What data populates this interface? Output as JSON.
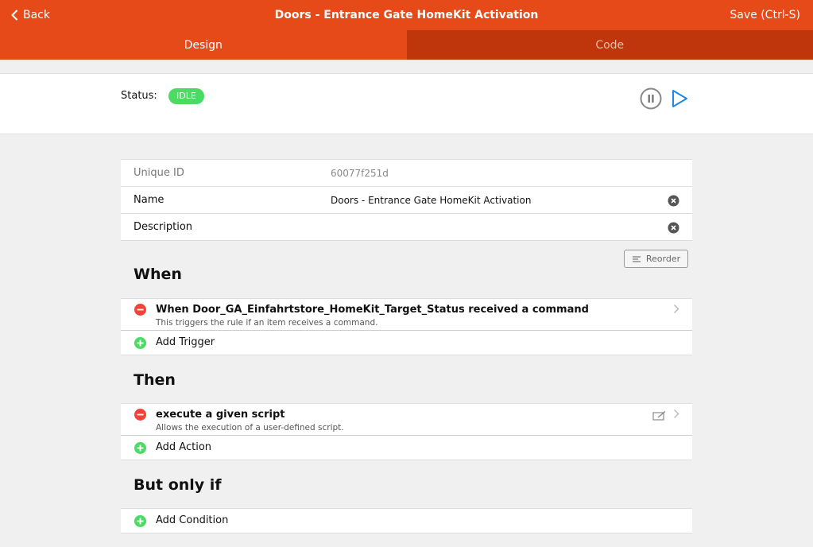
{
  "header": {
    "back_label": "Back",
    "title": "Doors - Entrance Gate HomeKit Activation",
    "save_label": "Save (Ctrl-S)",
    "accent_color": "#e64a19"
  },
  "tabs": [
    {
      "label": "Design",
      "active": true
    },
    {
      "label": "Code",
      "active": false
    }
  ],
  "status": {
    "label": "Status:",
    "badge": "IDLE",
    "badge_color": "#4cd964"
  },
  "properties": {
    "unique_id": {
      "label": "Unique ID",
      "value": "60077f251d"
    },
    "name": {
      "label": "Name",
      "value": "Doors - Entrance Gate HomeKit Activation"
    },
    "description": {
      "label": "Description",
      "value": ""
    }
  },
  "reorder_label": "Reorder",
  "sections": {
    "when": {
      "title": "When",
      "items": [
        {
          "title": "When Door_GA_Einfahrtstore_HomeKit_Target_Status received a command",
          "description": "This triggers the rule if an item receives a command."
        }
      ],
      "add_label": "Add Trigger"
    },
    "then": {
      "title": "Then",
      "items": [
        {
          "title": "execute a given script",
          "description": "Allows the execution of a user-defined script."
        }
      ],
      "add_label": "Add Action"
    },
    "but_only_if": {
      "title": "But only if",
      "add_label": "Add Condition"
    }
  },
  "icons": {
    "back": "chevron-left-icon",
    "pause": "pause-circle-icon",
    "play": "play-icon",
    "clear": "clear-circle-icon",
    "remove": "minus-circle-icon",
    "add": "plus-circle-icon",
    "chevron": "chevron-right-icon",
    "edit": "edit-script-icon",
    "reorder": "reorder-icon"
  }
}
